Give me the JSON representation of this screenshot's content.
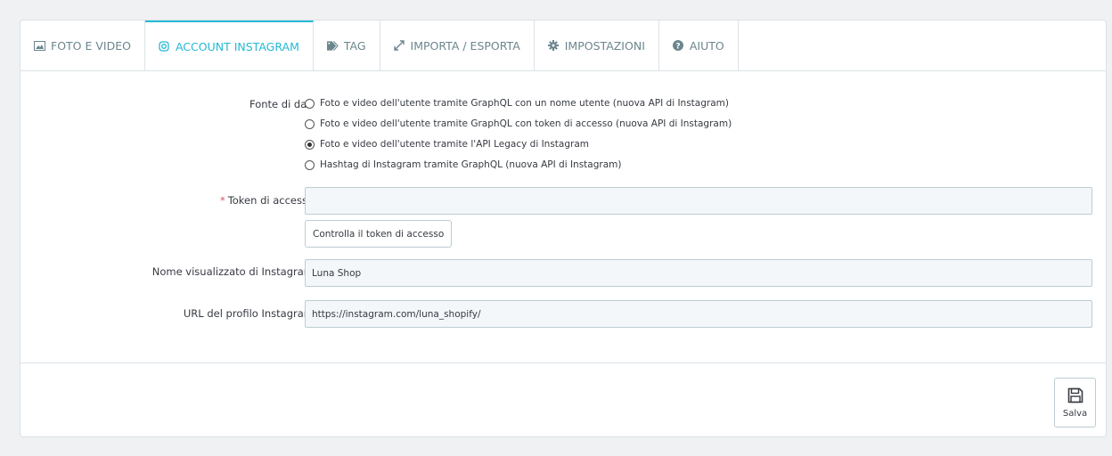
{
  "tabs": [
    {
      "label": "FOTO E VIDEO",
      "icon": "image-icon",
      "active": false
    },
    {
      "label": "ACCOUNT INSTAGRAM",
      "icon": "instagram-icon",
      "active": true
    },
    {
      "label": "TAG",
      "icon": "tags-icon",
      "active": false
    },
    {
      "label": "IMPORTA / ESPORTA",
      "icon": "arrows-icon",
      "active": false
    },
    {
      "label": "IMPOSTAZIONI",
      "icon": "gear-icon",
      "active": false
    },
    {
      "label": "AIUTO",
      "icon": "help-icon",
      "active": false
    }
  ],
  "form": {
    "source_label": "Fonte di dati",
    "source_options": [
      {
        "label": "Foto e video dell'utente tramite GraphQL con un nome utente (nuova API di Instagram)",
        "selected": false
      },
      {
        "label": "Foto e video dell'utente tramite GraphQL con token di accesso (nuova API di Instagram)",
        "selected": false
      },
      {
        "label": "Foto e video dell'utente tramite l'API Legacy di Instagram",
        "selected": true
      },
      {
        "label": "Hashtag di Instagram tramite GraphQL (nuova API di Instagram)",
        "selected": false
      }
    ],
    "token_required_mark": "*",
    "token_label": "Token di accesso",
    "token_value": "",
    "check_token_button": "Controlla il token di accesso",
    "display_name_label": "Nome visualizzato di Instagram",
    "display_name_value": "Luna Shop",
    "profile_url_label": "URL del profilo Instagram",
    "profile_url_value": "https://instagram.com/luna_shopify/"
  },
  "footer": {
    "save_label": "Salva",
    "save_icon": "floppy-icon"
  },
  "colors": {
    "accent": "#25b9d7",
    "required": "#c05c67"
  }
}
